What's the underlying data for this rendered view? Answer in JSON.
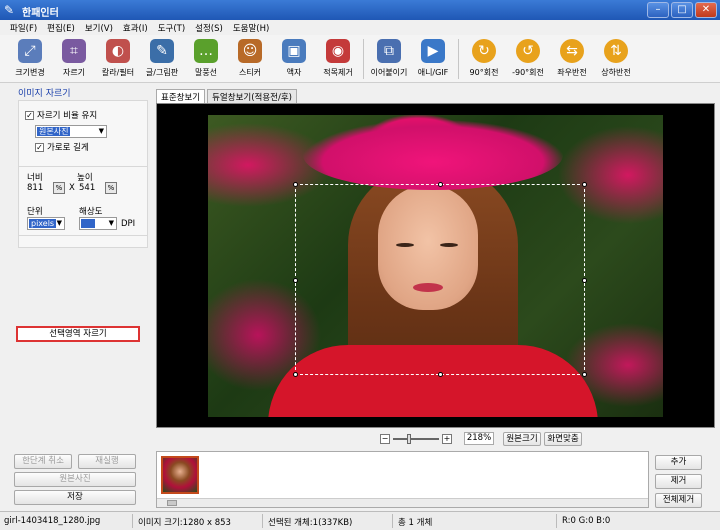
{
  "window": {
    "title": "한패인터"
  },
  "menu": [
    "파일(F)",
    "편집(E)",
    "보기(V)",
    "효과(I)",
    "도구(T)",
    "설정(S)",
    "도움말(H)"
  ],
  "toolbar": [
    {
      "label": "크기변경",
      "icon": "resize-icon",
      "color": "#5b7dbb"
    },
    {
      "label": "자르기",
      "icon": "crop-icon",
      "color": "#7a5aa0"
    },
    {
      "label": "칼라/필터",
      "icon": "color-filter-icon",
      "color": "#c0504d"
    },
    {
      "label": "글/그림판",
      "icon": "text-draw-icon",
      "color": "#3b6ea8"
    },
    {
      "label": "말풍선",
      "icon": "speech-bubble-icon",
      "color": "#5aa02c"
    },
    {
      "label": "스티커",
      "icon": "sticker-icon",
      "color": "#b86a28"
    },
    {
      "label": "액자",
      "icon": "frame-icon",
      "color": "#4a7bbd"
    },
    {
      "label": "적목제거",
      "icon": "red-eye-icon",
      "color": "#c43a3a"
    },
    {
      "label": "이어붙이기",
      "icon": "merge-icon",
      "color": "#4a6fb0"
    },
    {
      "label": "애니/GIF",
      "icon": "gif-icon",
      "color": "#3a78c8"
    },
    {
      "label": "90°회전",
      "icon": "rotate-cw-icon",
      "color": "#e8a21c"
    },
    {
      "label": "-90°회전",
      "icon": "rotate-ccw-icon",
      "color": "#e8a21c"
    },
    {
      "label": "좌우반전",
      "icon": "flip-horizontal-icon",
      "color": "#e8a21c"
    },
    {
      "label": "상하반전",
      "icon": "flip-vertical-icon",
      "color": "#e8a21c"
    }
  ],
  "left": {
    "section_title": "이미지 자르기",
    "keep_ratio_label": "자르기 비율 유지",
    "ratio_select": "원본사진",
    "landscape_label": "가로로 길게",
    "width_label": "너비",
    "height_label": "높이",
    "width_value": "811",
    "height_value": "541",
    "x_sep": "X",
    "unit_label": "단위",
    "unit_value": "pixels",
    "dpi_label": "해상도",
    "dpi_value": "",
    "dpi_unit": "DPI",
    "crop_button": "선택영역 자르기",
    "undo": "한단계 취소",
    "redo": "재실행",
    "original": "원본사진",
    "save": "저장"
  },
  "tabs": [
    "표준창보기",
    "듀얼창보기(적용전/후)"
  ],
  "zoom": {
    "value": "218%",
    "original_btn": "원본크기",
    "fit_btn": "화면맞춤"
  },
  "right_buttons": {
    "add": "추가",
    "remove": "제거",
    "remove_all": "전체제거"
  },
  "status": {
    "filename": "girl-1403418_1280.jpg",
    "image_size": "이미지 크기:1280 x 853",
    "selected": "선택된 개체:1(337KB)",
    "total": "총 1 개체",
    "rgb": "R:0 G:0 B:0"
  }
}
